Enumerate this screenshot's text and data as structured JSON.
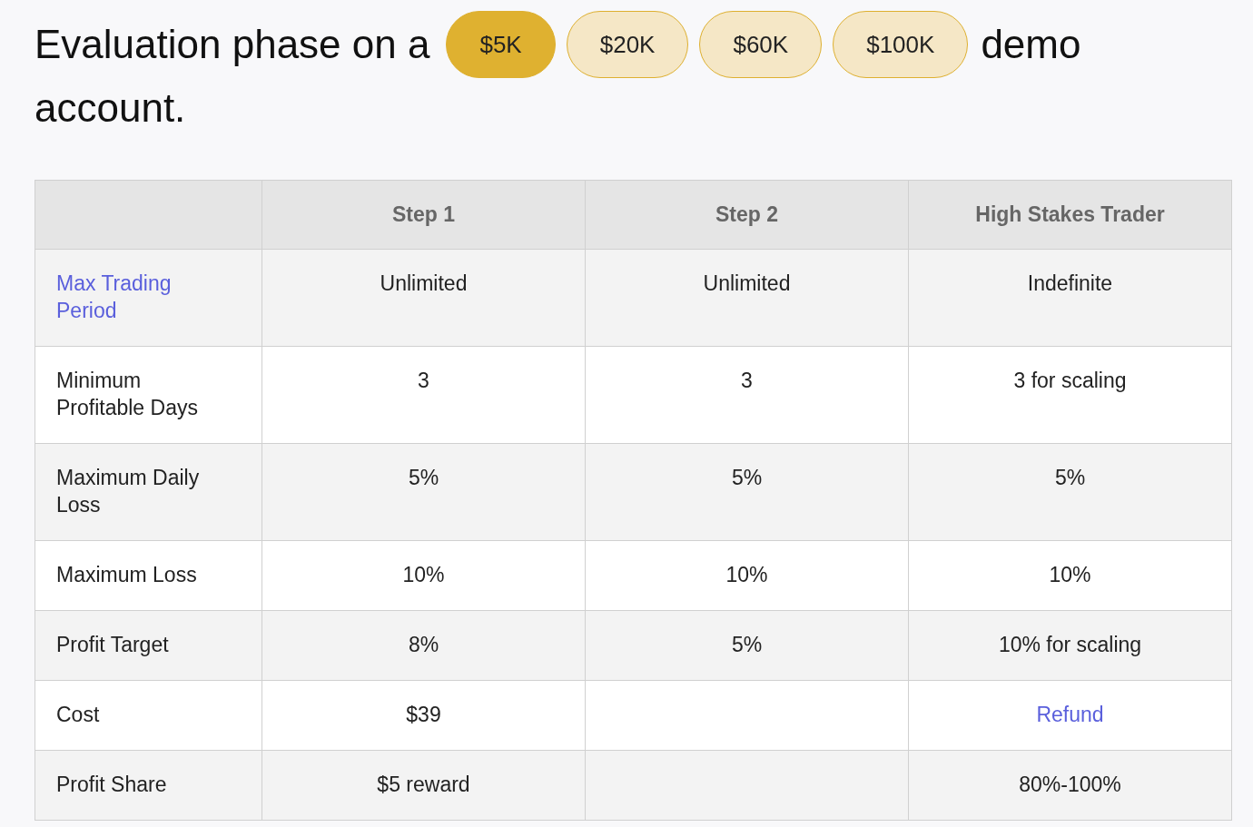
{
  "heading": {
    "before": "Evaluation phase on a",
    "after": "demo",
    "continuation": "account."
  },
  "plans": [
    {
      "label": "$5K",
      "selected": true
    },
    {
      "label": "$20K",
      "selected": false
    },
    {
      "label": "$60K",
      "selected": false
    },
    {
      "label": "$100K",
      "selected": false
    }
  ],
  "table": {
    "columns": [
      "",
      "Step 1",
      "Step 2",
      "High Stakes Trader"
    ],
    "rows": [
      {
        "cells": [
          {
            "text": "Max Trading Period",
            "kind": "link"
          },
          {
            "text": "Unlimited",
            "kind": "text"
          },
          {
            "text": "Unlimited",
            "kind": "text"
          },
          {
            "text": "Indefinite",
            "kind": "text"
          }
        ]
      },
      {
        "cells": [
          {
            "text": "Minimum Profitable Days",
            "kind": "text"
          },
          {
            "text": "3",
            "kind": "text"
          },
          {
            "text": "3",
            "kind": "text"
          },
          {
            "text": "3 for scaling",
            "kind": "text"
          }
        ]
      },
      {
        "cells": [
          {
            "text": "Maximum Daily Loss",
            "kind": "text"
          },
          {
            "text": "5%",
            "kind": "text"
          },
          {
            "text": "5%",
            "kind": "text"
          },
          {
            "text": "5%",
            "kind": "text"
          }
        ]
      },
      {
        "cells": [
          {
            "text": "Maximum Loss",
            "kind": "text"
          },
          {
            "text": "10%",
            "kind": "text"
          },
          {
            "text": "10%",
            "kind": "text"
          },
          {
            "text": "10%",
            "kind": "text"
          }
        ]
      },
      {
        "cells": [
          {
            "text": "Profit Target",
            "kind": "text"
          },
          {
            "text": "8%",
            "kind": "text"
          },
          {
            "text": "5%",
            "kind": "text"
          },
          {
            "text": "10% for scaling",
            "kind": "text"
          }
        ]
      },
      {
        "cells": [
          {
            "text": "Cost",
            "kind": "text"
          },
          {
            "text": "$39",
            "kind": "text"
          },
          {
            "text": "",
            "kind": "empty"
          },
          {
            "text": "Refund",
            "kind": "link"
          }
        ]
      },
      {
        "cells": [
          {
            "text": "Profit Share",
            "kind": "text"
          },
          {
            "text": "$5 reward",
            "kind": "text"
          },
          {
            "text": "",
            "kind": "empty"
          },
          {
            "text": "80%-100%",
            "kind": "text"
          }
        ]
      }
    ]
  }
}
